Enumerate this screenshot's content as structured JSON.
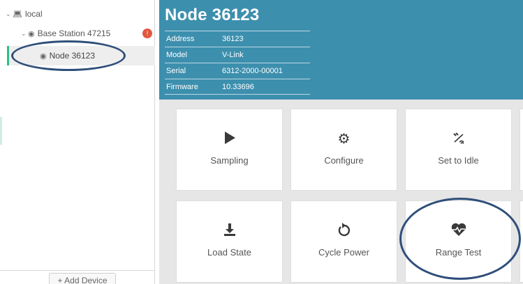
{
  "sidebar": {
    "tree": {
      "local_label": "local",
      "base_station_label": "Base Station 47215",
      "base_station_badge": "!",
      "node_label": "Node 36123"
    },
    "add_device_label": "+ Add Device"
  },
  "header": {
    "title": "Node 36123",
    "properties": [
      {
        "key": "Address",
        "value": "36123"
      },
      {
        "key": "Model",
        "value": "V-Link"
      },
      {
        "key": "Serial",
        "value": "6312-2000-00001"
      },
      {
        "key": "Firmware",
        "value": "10.33696"
      }
    ]
  },
  "actions": [
    {
      "label": "Sampling",
      "icon": "play-icon"
    },
    {
      "label": "Configure",
      "icon": "gear-icon"
    },
    {
      "label": "Set to Idle",
      "icon": "idle-signal-icon"
    },
    {
      "label": "Load State",
      "icon": "download-icon"
    },
    {
      "label": "Cycle Power",
      "icon": "refresh-icon"
    },
    {
      "label": "Range Test",
      "icon": "heartbeat-icon"
    }
  ],
  "colors": {
    "header_bg": "#3d8fae",
    "selected_accent": "#2bbf87",
    "badge": "#e2573f",
    "annotation": "#2f4f7a"
  }
}
